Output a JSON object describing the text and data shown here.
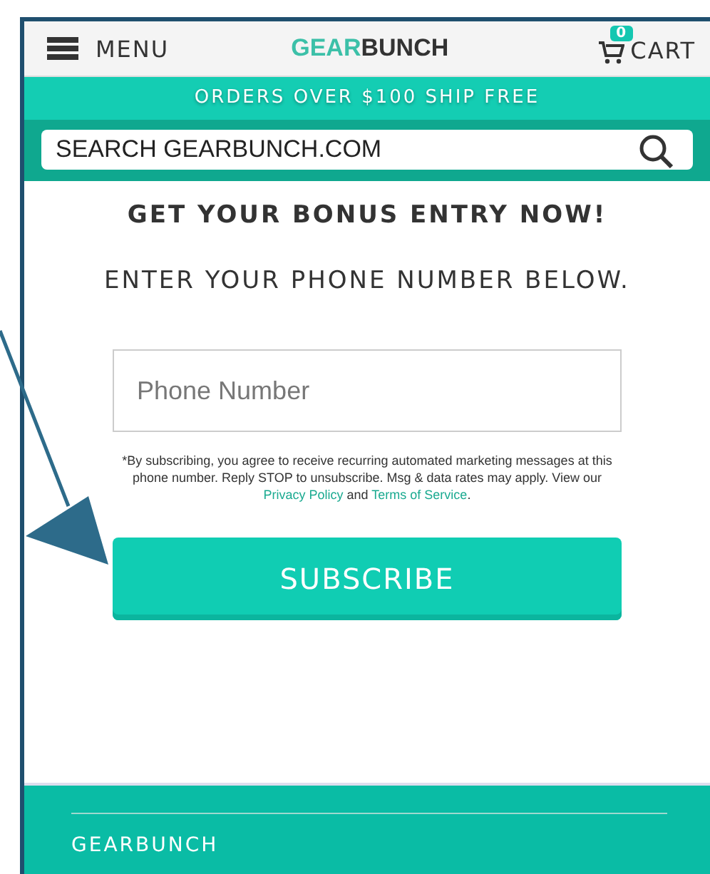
{
  "header": {
    "menu_label": "MENU",
    "logo": {
      "accent": "GEAR",
      "main": "BUNCH"
    },
    "cart_count": "0",
    "cart_label": "CART"
  },
  "promo_banner": "ORDERS OVER $100 SHIP FREE",
  "search": {
    "placeholder": "SEARCH GEARBUNCH.COM"
  },
  "heading": "GET YOUR BONUS ENTRY NOW!",
  "subheading": "ENTER YOUR PHONE NUMBER BELOW.",
  "phone_field": {
    "placeholder": "Phone Number"
  },
  "disclaimer": {
    "text": "*By subscribing, you agree to receive recurring automated marketing messages at this phone number. Reply STOP to unsubscribe. Msg & data rates may apply. View our ",
    "link_1": "Privacy Policy",
    "middle": " and ",
    "link_2": "Terms of Service",
    "end": "."
  },
  "subscribe_button": "SUBSCRIBE",
  "footer": {
    "title": "GEARBUNCH"
  }
}
